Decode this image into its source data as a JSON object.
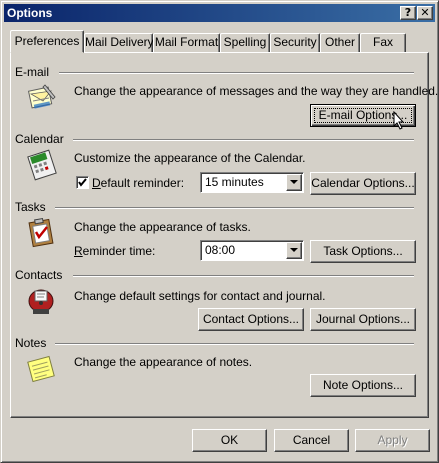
{
  "window": {
    "title": "Options",
    "help_button": "?",
    "close_button": "✕"
  },
  "tabs": [
    {
      "label": "Preferences",
      "active": true
    },
    {
      "label": "Mail Delivery",
      "active": false
    },
    {
      "label": "Mail Format",
      "active": false
    },
    {
      "label": "Spelling",
      "active": false
    },
    {
      "label": "Security",
      "active": false
    },
    {
      "label": "Other",
      "active": false
    },
    {
      "label": "Fax",
      "active": false
    }
  ],
  "email": {
    "heading": "E-mail",
    "description": "Change the appearance of messages and the way they are handled.",
    "button_label": "E-mail Options..."
  },
  "calendar": {
    "heading": "Calendar",
    "description": "Customize the appearance of the Calendar.",
    "reminder_checked": true,
    "reminder_label": "Default reminder:",
    "reminder_value": "15 minutes",
    "button_label": "Calendar Options..."
  },
  "tasks": {
    "heading": "Tasks",
    "description": "Change the appearance of tasks.",
    "reminder_label": "Reminder time:",
    "reminder_value": "08:00",
    "button_label": "Task Options..."
  },
  "contacts": {
    "heading": "Contacts",
    "description": "Change default settings for contact and journal.",
    "contact_button_label": "Contact Options...",
    "journal_button_label": "Journal Options..."
  },
  "notes": {
    "heading": "Notes",
    "description": "Change the appearance of notes.",
    "button_label": "Note Options..."
  },
  "footer": {
    "ok_label": "OK",
    "cancel_label": "Cancel",
    "apply_label": "Apply",
    "apply_enabled": false
  }
}
